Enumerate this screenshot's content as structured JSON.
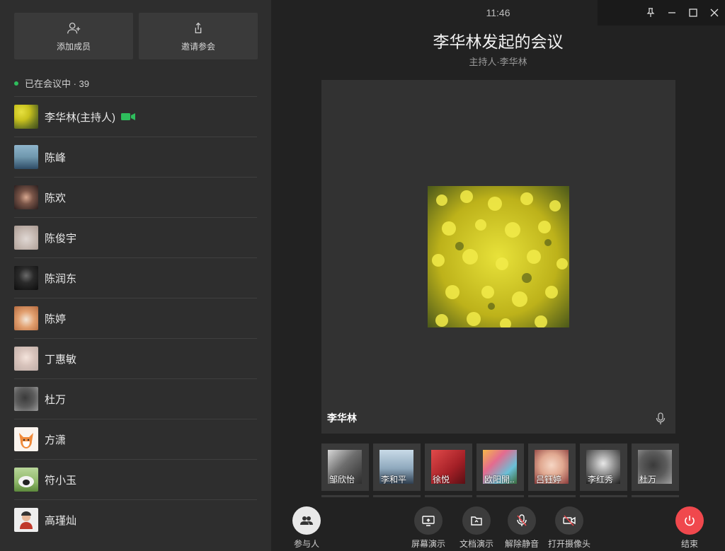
{
  "sidebar": {
    "add_member": "添加成员",
    "invite": "邀请参会",
    "status_text": "已在会议中 · 39",
    "members": [
      {
        "name": "李华林(主持人)",
        "avatar": "flowers",
        "camera_on": true
      },
      {
        "name": "陈峰",
        "avatar": "sea"
      },
      {
        "name": "陈欢",
        "avatar": "girl-dark"
      },
      {
        "name": "陈俊宇",
        "avatar": "pale"
      },
      {
        "name": "陈润东",
        "avatar": "dark"
      },
      {
        "name": "陈婷",
        "avatar": "cat"
      },
      {
        "name": "丁惠敏",
        "avatar": "girl-light"
      },
      {
        "name": "杜万",
        "avatar": "silhouette"
      },
      {
        "name": "方潇",
        "avatar": "fox"
      },
      {
        "name": "符小玉",
        "avatar": "sheep"
      },
      {
        "name": "高瑾灿",
        "avatar": "person-red"
      }
    ]
  },
  "window": {
    "pin": "pin-icon",
    "minimize": "minimize-icon",
    "maximize": "maximize-icon",
    "close": "close-icon"
  },
  "meeting": {
    "time": "11:46",
    "title": "李华林发起的会议",
    "host": "主持人·李华林",
    "speaker_name": "李华林"
  },
  "thumbnails": [
    {
      "name": "邹欣怡",
      "avatar": "abstract"
    },
    {
      "name": "李和平",
      "avatar": "sky"
    },
    {
      "name": "徐悦",
      "avatar": "red"
    },
    {
      "name": "欧阳開..",
      "avatar": "colorful"
    },
    {
      "name": "吕钰婷",
      "avatar": "child"
    },
    {
      "name": "李红秀",
      "avatar": "woman"
    },
    {
      "name": "杜万",
      "avatar": "silhouette"
    }
  ],
  "toolbar": {
    "participants": "参与人",
    "screen_share": "屏幕演示",
    "doc_share": "文档演示",
    "unmute": "解除静音",
    "camera_on": "打开摄像头",
    "end": "结束"
  },
  "colors": {
    "accent_green": "#2ebd5c",
    "end_red": "#f0484d",
    "sidebar_bg": "#2e2e2e"
  }
}
